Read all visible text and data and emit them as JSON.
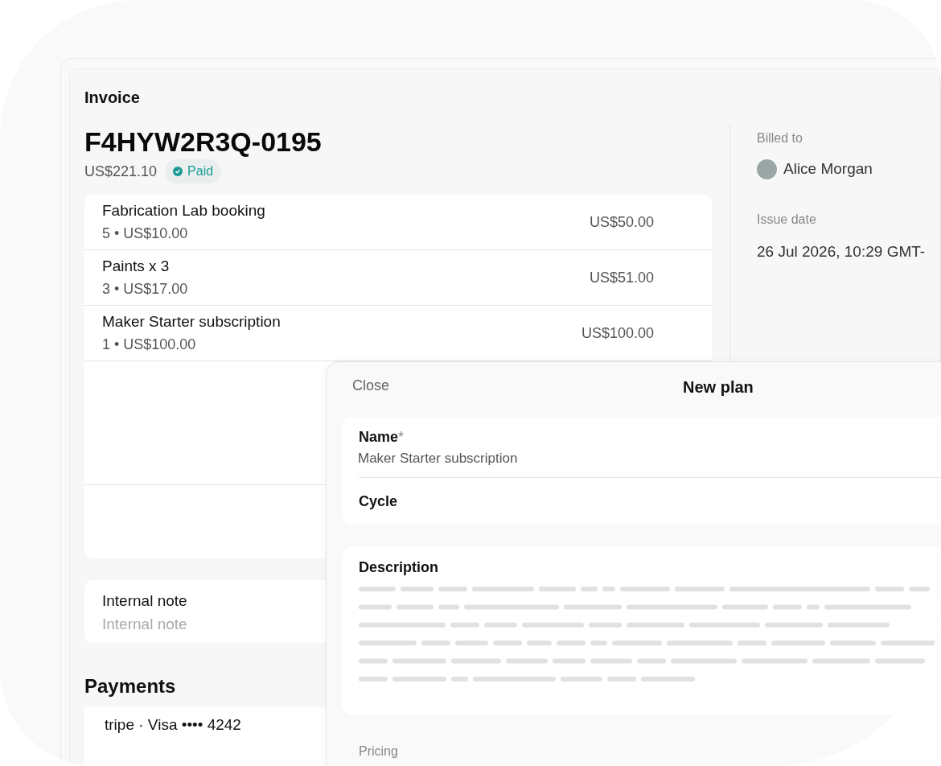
{
  "invoice": {
    "heading": "Invoice",
    "number": "F4HYW2R3Q-0195",
    "total": "US$221.10",
    "status": {
      "label": "Paid",
      "kind": "paid"
    },
    "items": [
      {
        "name": "Fabrication Lab booking",
        "detail": "5 • US$10.00",
        "amount": "US$50.00"
      },
      {
        "name": "Paints x 3",
        "detail": "3 • US$17.00",
        "amount": "US$51.00"
      },
      {
        "name": "Maker Starter subscription",
        "detail": "1 • US$100.00",
        "amount": "US$100.00"
      }
    ],
    "internal_note": {
      "label": "Internal note",
      "placeholder": "Internal note"
    },
    "payments": {
      "heading": "Payments",
      "method": "tripe · Visa •••• 4242"
    },
    "billed_to": {
      "label": "Billed to",
      "name": "Alice Morgan"
    },
    "issue_date": {
      "label": "Issue date",
      "value": "26 Jul 2026, 10:29 GMT-"
    }
  },
  "new_plan": {
    "close": "Close",
    "title": "New plan",
    "name": {
      "label": "Name",
      "required_mark": "*",
      "value": "Maker Starter subscription"
    },
    "cycle": {
      "label": "Cycle"
    },
    "description": {
      "label": "Description"
    },
    "pricing": {
      "label": "Pricing"
    }
  }
}
